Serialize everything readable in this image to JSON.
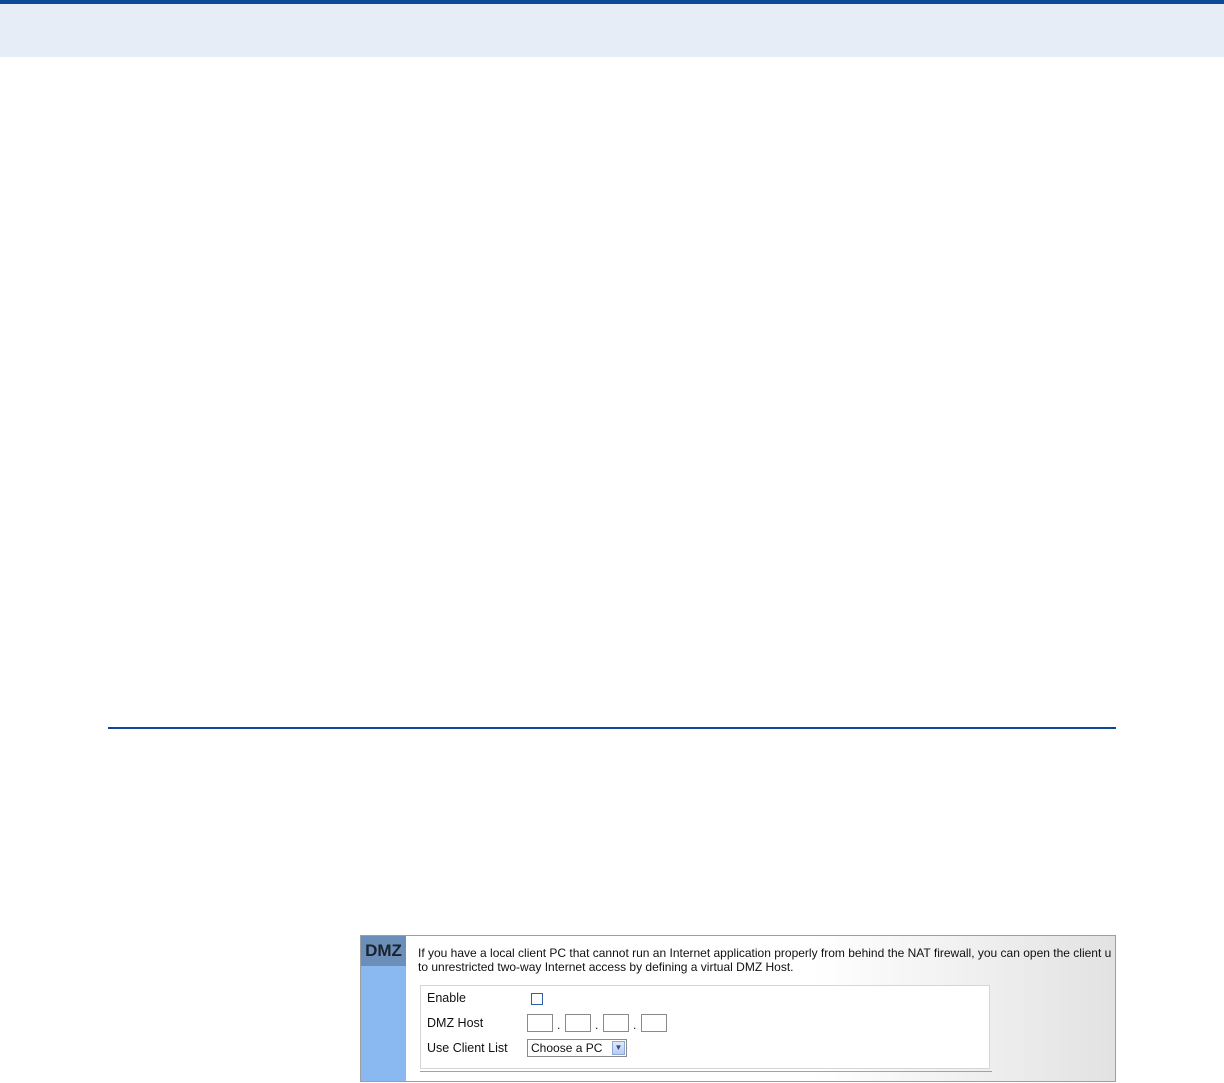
{
  "panel": {
    "title": "DMZ",
    "description_line1": "If you have a local client PC that cannot run an Internet application properly from behind the NAT firewall, you can open the client u",
    "description_line2": "to unrestricted two-way Internet access by defining a virtual DMZ Host.",
    "enable_label": "Enable",
    "enable_checked": false,
    "dmz_host_label": "DMZ Host",
    "ip_octets": [
      "",
      "",
      "",
      ""
    ],
    "ip_separator": ".",
    "client_list_label": "Use Client List",
    "client_list_selected": "Choose a PC",
    "dropdown_icon": "chevron-down-icon"
  },
  "colors": {
    "accent_blue": "#0a4a98",
    "header_band": "#e6edf6",
    "panel_side": "#8ab9f2",
    "panel_title_bg": "#6b8fb8"
  }
}
